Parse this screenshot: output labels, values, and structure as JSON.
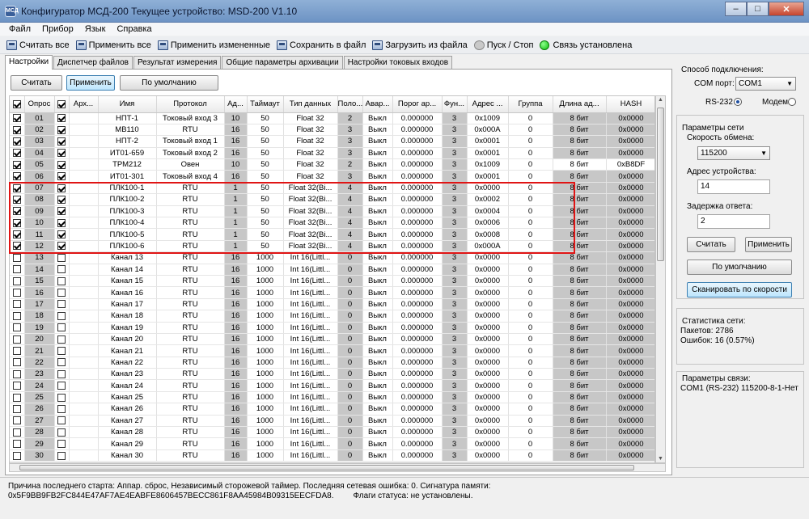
{
  "window": {
    "icon_text": "МСД",
    "title": "Конфигуратор МСД-200   Текущее устройство: MSD-200 V1.10",
    "minimize": "–",
    "maximize": "□",
    "close": "✕"
  },
  "menu": [
    "Файл",
    "Прибор",
    "Язык",
    "Справка"
  ],
  "toolbar": [
    {
      "label": "Считать все",
      "icon": "read-icon"
    },
    {
      "label": "Применить все",
      "icon": "apply-icon"
    },
    {
      "label": "Применить измененные",
      "icon": "apply-changed-icon"
    },
    {
      "label": "Сохранить в файл",
      "icon": "save-icon"
    },
    {
      "label": "Загрузить из файла",
      "icon": "load-icon"
    },
    {
      "label": "Пуск / Стоп",
      "icon": "play-icon"
    }
  ],
  "connection_status": {
    "label": "Связь установлена",
    "color": "#0cbe0c"
  },
  "tabs": [
    "Настройки",
    "Диспетчер файлов",
    "Результат измерения",
    "Общие параметры архивации",
    "Настройки токовых входов"
  ],
  "actions": {
    "read": "Считать",
    "apply": "Применить",
    "defaults": "По умолчанию"
  },
  "table": {
    "columns": [
      "",
      "Опрос",
      "",
      "Арх...",
      "Имя",
      "Протокол",
      "Ад...",
      "Таймаут",
      "Тип данных",
      "Поло...",
      "Авар...",
      "Порог ар...",
      "Фун...",
      "Адрес ...",
      "Группа",
      "Длина ад...",
      "HASH"
    ],
    "rows": [
      {
        "poll": true,
        "num": "01",
        "arch": true,
        "name": "НПТ-1",
        "proto": "Токовый вход 3",
        "addr": "10",
        "timeout": "50",
        "type": "Float 32",
        "pos": "2",
        "alarm": "Выкл",
        "thr": "0.000000",
        "func": "3",
        "raddr": "0x1009",
        "group": "0",
        "len": "8 бит",
        "hash": "0x0000"
      },
      {
        "poll": true,
        "num": "02",
        "arch": true,
        "name": "МВ110",
        "proto": "RTU",
        "addr": "16",
        "timeout": "50",
        "type": "Float 32",
        "pos": "3",
        "alarm": "Выкл",
        "thr": "0.000000",
        "func": "3",
        "raddr": "0x000A",
        "group": "0",
        "len": "8 бит",
        "hash": "0x0000"
      },
      {
        "poll": true,
        "num": "03",
        "arch": true,
        "name": "НПТ-2",
        "proto": "Токовый вход 1",
        "addr": "16",
        "timeout": "50",
        "type": "Float 32",
        "pos": "3",
        "alarm": "Выкл",
        "thr": "0.000000",
        "func": "3",
        "raddr": "0x0001",
        "group": "0",
        "len": "8 бит",
        "hash": "0x0000"
      },
      {
        "poll": true,
        "num": "04",
        "arch": true,
        "name": "ИТ01-659",
        "proto": "Токовый вход 2",
        "addr": "16",
        "timeout": "50",
        "type": "Float 32",
        "pos": "3",
        "alarm": "Выкл",
        "thr": "0.000000",
        "func": "3",
        "raddr": "0x0001",
        "group": "0",
        "len": "8 бит",
        "hash": "0x0000"
      },
      {
        "poll": true,
        "num": "05",
        "arch": true,
        "name": "ТРМ212",
        "proto": "Овен",
        "addr": "10",
        "timeout": "50",
        "type": "Float 32",
        "pos": "2",
        "alarm": "Выкл",
        "thr": "0.000000",
        "func": "3",
        "raddr": "0x1009",
        "group": "0",
        "len": "8 бит",
        "hash": "0xB8DF"
      },
      {
        "poll": true,
        "num": "06",
        "arch": true,
        "name": "ИТ01-301",
        "proto": "Токовый вход 4",
        "addr": "16",
        "timeout": "50",
        "type": "Float 32",
        "pos": "3",
        "alarm": "Выкл",
        "thr": "0.000000",
        "func": "3",
        "raddr": "0x0001",
        "group": "0",
        "len": "8 бит",
        "hash": "0x0000"
      },
      {
        "poll": true,
        "num": "07",
        "arch": true,
        "name": "ПЛК100-1",
        "proto": "RTU",
        "addr": "1",
        "timeout": "50",
        "type": "Float 32(Bi...",
        "pos": "4",
        "alarm": "Выкл",
        "thr": "0.000000",
        "func": "3",
        "raddr": "0x0000",
        "group": "0",
        "len": "8 бит",
        "hash": "0x0000"
      },
      {
        "poll": true,
        "num": "08",
        "arch": true,
        "name": "ПЛК100-2",
        "proto": "RTU",
        "addr": "1",
        "timeout": "50",
        "type": "Float 32(Bi...",
        "pos": "4",
        "alarm": "Выкл",
        "thr": "0.000000",
        "func": "3",
        "raddr": "0x0002",
        "group": "0",
        "len": "8 бит",
        "hash": "0x0000"
      },
      {
        "poll": true,
        "num": "09",
        "arch": true,
        "name": "ПЛК100-3",
        "proto": "RTU",
        "addr": "1",
        "timeout": "50",
        "type": "Float 32(Bi...",
        "pos": "4",
        "alarm": "Выкл",
        "thr": "0.000000",
        "func": "3",
        "raddr": "0x0004",
        "group": "0",
        "len": "8 бит",
        "hash": "0x0000"
      },
      {
        "poll": true,
        "num": "10",
        "arch": true,
        "name": "ПЛК100-4",
        "proto": "RTU",
        "addr": "1",
        "timeout": "50",
        "type": "Float 32(Bi...",
        "pos": "4",
        "alarm": "Выкл",
        "thr": "0.000000",
        "func": "3",
        "raddr": "0x0006",
        "group": "0",
        "len": "8 бит",
        "hash": "0x0000"
      },
      {
        "poll": true,
        "num": "11",
        "arch": true,
        "name": "ПЛК100-5",
        "proto": "RTU",
        "addr": "1",
        "timeout": "50",
        "type": "Float 32(Bi...",
        "pos": "4",
        "alarm": "Выкл",
        "thr": "0.000000",
        "func": "3",
        "raddr": "0x0008",
        "group": "0",
        "len": "8 бит",
        "hash": "0x0000"
      },
      {
        "poll": true,
        "num": "12",
        "arch": true,
        "name": "ПЛК100-6",
        "proto": "RTU",
        "addr": "1",
        "timeout": "50",
        "type": "Float 32(Bi...",
        "pos": "4",
        "alarm": "Выкл",
        "thr": "0.000000",
        "func": "3",
        "raddr": "0x000A",
        "group": "0",
        "len": "8 бит",
        "hash": "0x0000"
      },
      {
        "poll": false,
        "num": "13",
        "arch": false,
        "name": "Канал 13",
        "proto": "RTU",
        "addr": "16",
        "timeout": "1000",
        "type": "Int 16(Littl...",
        "pos": "0",
        "alarm": "Выкл",
        "thr": "0.000000",
        "func": "3",
        "raddr": "0x0000",
        "group": "0",
        "len": "8 бит",
        "hash": "0x0000"
      },
      {
        "poll": false,
        "num": "14",
        "arch": false,
        "name": "Канал 14",
        "proto": "RTU",
        "addr": "16",
        "timeout": "1000",
        "type": "Int 16(Littl...",
        "pos": "0",
        "alarm": "Выкл",
        "thr": "0.000000",
        "func": "3",
        "raddr": "0x0000",
        "group": "0",
        "len": "8 бит",
        "hash": "0x0000"
      },
      {
        "poll": false,
        "num": "15",
        "arch": false,
        "name": "Канал 15",
        "proto": "RTU",
        "addr": "16",
        "timeout": "1000",
        "type": "Int 16(Littl...",
        "pos": "0",
        "alarm": "Выкл",
        "thr": "0.000000",
        "func": "3",
        "raddr": "0x0000",
        "group": "0",
        "len": "8 бит",
        "hash": "0x0000"
      },
      {
        "poll": false,
        "num": "16",
        "arch": false,
        "name": "Канал 16",
        "proto": "RTU",
        "addr": "16",
        "timeout": "1000",
        "type": "Int 16(Littl...",
        "pos": "0",
        "alarm": "Выкл",
        "thr": "0.000000",
        "func": "3",
        "raddr": "0x0000",
        "group": "0",
        "len": "8 бит",
        "hash": "0x0000"
      },
      {
        "poll": false,
        "num": "17",
        "arch": false,
        "name": "Канал 17",
        "proto": "RTU",
        "addr": "16",
        "timeout": "1000",
        "type": "Int 16(Littl...",
        "pos": "0",
        "alarm": "Выкл",
        "thr": "0.000000",
        "func": "3",
        "raddr": "0x0000",
        "group": "0",
        "len": "8 бит",
        "hash": "0x0000"
      },
      {
        "poll": false,
        "num": "18",
        "arch": false,
        "name": "Канал 18",
        "proto": "RTU",
        "addr": "16",
        "timeout": "1000",
        "type": "Int 16(Littl...",
        "pos": "0",
        "alarm": "Выкл",
        "thr": "0.000000",
        "func": "3",
        "raddr": "0x0000",
        "group": "0",
        "len": "8 бит",
        "hash": "0x0000"
      },
      {
        "poll": false,
        "num": "19",
        "arch": false,
        "name": "Канал 19",
        "proto": "RTU",
        "addr": "16",
        "timeout": "1000",
        "type": "Int 16(Littl...",
        "pos": "0",
        "alarm": "Выкл",
        "thr": "0.000000",
        "func": "3",
        "raddr": "0x0000",
        "group": "0",
        "len": "8 бит",
        "hash": "0x0000"
      },
      {
        "poll": false,
        "num": "20",
        "arch": false,
        "name": "Канал 20",
        "proto": "RTU",
        "addr": "16",
        "timeout": "1000",
        "type": "Int 16(Littl...",
        "pos": "0",
        "alarm": "Выкл",
        "thr": "0.000000",
        "func": "3",
        "raddr": "0x0000",
        "group": "0",
        "len": "8 бит",
        "hash": "0x0000"
      },
      {
        "poll": false,
        "num": "21",
        "arch": false,
        "name": "Канал 21",
        "proto": "RTU",
        "addr": "16",
        "timeout": "1000",
        "type": "Int 16(Littl...",
        "pos": "0",
        "alarm": "Выкл",
        "thr": "0.000000",
        "func": "3",
        "raddr": "0x0000",
        "group": "0",
        "len": "8 бит",
        "hash": "0x0000"
      },
      {
        "poll": false,
        "num": "22",
        "arch": false,
        "name": "Канал 22",
        "proto": "RTU",
        "addr": "16",
        "timeout": "1000",
        "type": "Int 16(Littl...",
        "pos": "0",
        "alarm": "Выкл",
        "thr": "0.000000",
        "func": "3",
        "raddr": "0x0000",
        "group": "0",
        "len": "8 бит",
        "hash": "0x0000"
      },
      {
        "poll": false,
        "num": "23",
        "arch": false,
        "name": "Канал 23",
        "proto": "RTU",
        "addr": "16",
        "timeout": "1000",
        "type": "Int 16(Littl...",
        "pos": "0",
        "alarm": "Выкл",
        "thr": "0.000000",
        "func": "3",
        "raddr": "0x0000",
        "group": "0",
        "len": "8 бит",
        "hash": "0x0000"
      },
      {
        "poll": false,
        "num": "24",
        "arch": false,
        "name": "Канал 24",
        "proto": "RTU",
        "addr": "16",
        "timeout": "1000",
        "type": "Int 16(Littl...",
        "pos": "0",
        "alarm": "Выкл",
        "thr": "0.000000",
        "func": "3",
        "raddr": "0x0000",
        "group": "0",
        "len": "8 бит",
        "hash": "0x0000"
      },
      {
        "poll": false,
        "num": "25",
        "arch": false,
        "name": "Канал 25",
        "proto": "RTU",
        "addr": "16",
        "timeout": "1000",
        "type": "Int 16(Littl...",
        "pos": "0",
        "alarm": "Выкл",
        "thr": "0.000000",
        "func": "3",
        "raddr": "0x0000",
        "group": "0",
        "len": "8 бит",
        "hash": "0x0000"
      },
      {
        "poll": false,
        "num": "26",
        "arch": false,
        "name": "Канал 26",
        "proto": "RTU",
        "addr": "16",
        "timeout": "1000",
        "type": "Int 16(Littl...",
        "pos": "0",
        "alarm": "Выкл",
        "thr": "0.000000",
        "func": "3",
        "raddr": "0x0000",
        "group": "0",
        "len": "8 бит",
        "hash": "0x0000"
      },
      {
        "poll": false,
        "num": "27",
        "arch": false,
        "name": "Канал 27",
        "proto": "RTU",
        "addr": "16",
        "timeout": "1000",
        "type": "Int 16(Littl...",
        "pos": "0",
        "alarm": "Выкл",
        "thr": "0.000000",
        "func": "3",
        "raddr": "0x0000",
        "group": "0",
        "len": "8 бит",
        "hash": "0x0000"
      },
      {
        "poll": false,
        "num": "28",
        "arch": false,
        "name": "Канал 28",
        "proto": "RTU",
        "addr": "16",
        "timeout": "1000",
        "type": "Int 16(Littl...",
        "pos": "0",
        "alarm": "Выкл",
        "thr": "0.000000",
        "func": "3",
        "raddr": "0x0000",
        "group": "0",
        "len": "8 бит",
        "hash": "0x0000"
      },
      {
        "poll": false,
        "num": "29",
        "arch": false,
        "name": "Канал 29",
        "proto": "RTU",
        "addr": "16",
        "timeout": "1000",
        "type": "Int 16(Littl...",
        "pos": "0",
        "alarm": "Выкл",
        "thr": "0.000000",
        "func": "3",
        "raddr": "0x0000",
        "group": "0",
        "len": "8 бит",
        "hash": "0x0000"
      },
      {
        "poll": false,
        "num": "30",
        "arch": false,
        "name": "Канал 30",
        "proto": "RTU",
        "addr": "16",
        "timeout": "1000",
        "type": "Int 16(Littl...",
        "pos": "0",
        "alarm": "Выкл",
        "thr": "0.000000",
        "func": "3",
        "raddr": "0x0000",
        "group": "0",
        "len": "8 бит",
        "hash": "0x0000"
      }
    ]
  },
  "connection": {
    "title": "Способ подключения:",
    "com_label": "COM порт:",
    "com_value": "COM1",
    "rs232": "RS-232",
    "modem": "Модем"
  },
  "network": {
    "title": "Параметры сети",
    "baud_label": "Скорость обмена:",
    "baud_value": "115200",
    "addr_label": "Адрес устройства:",
    "addr_value": "14",
    "delay_label": "Задержка ответа:",
    "delay_value": "2",
    "read": "Считать",
    "apply": "Применить",
    "defaults": "По умолчанию",
    "scan": "Сканировать по скорости"
  },
  "stats": {
    "title": "Статистика сети:",
    "packets": "Пакетов: 2786",
    "errors": "Ошибок: 16 (0.57%)"
  },
  "link": {
    "title": "Параметры связи:",
    "value": "COM1 (RS-232)   115200-8-1-Нет"
  },
  "status": {
    "line1": "Причина последнего старта: Аппар. сброс, Независимый сторожевой таймер. Последняя сетевая ошибка: 0. Сигнатура памяти:",
    "signature": "0x5F9BB9FB2FC844E47AF7AE4EABFE8606457BECC861F8AA45984B09315EECFDA8.",
    "flags": "Флаги статуса: не установлены."
  }
}
